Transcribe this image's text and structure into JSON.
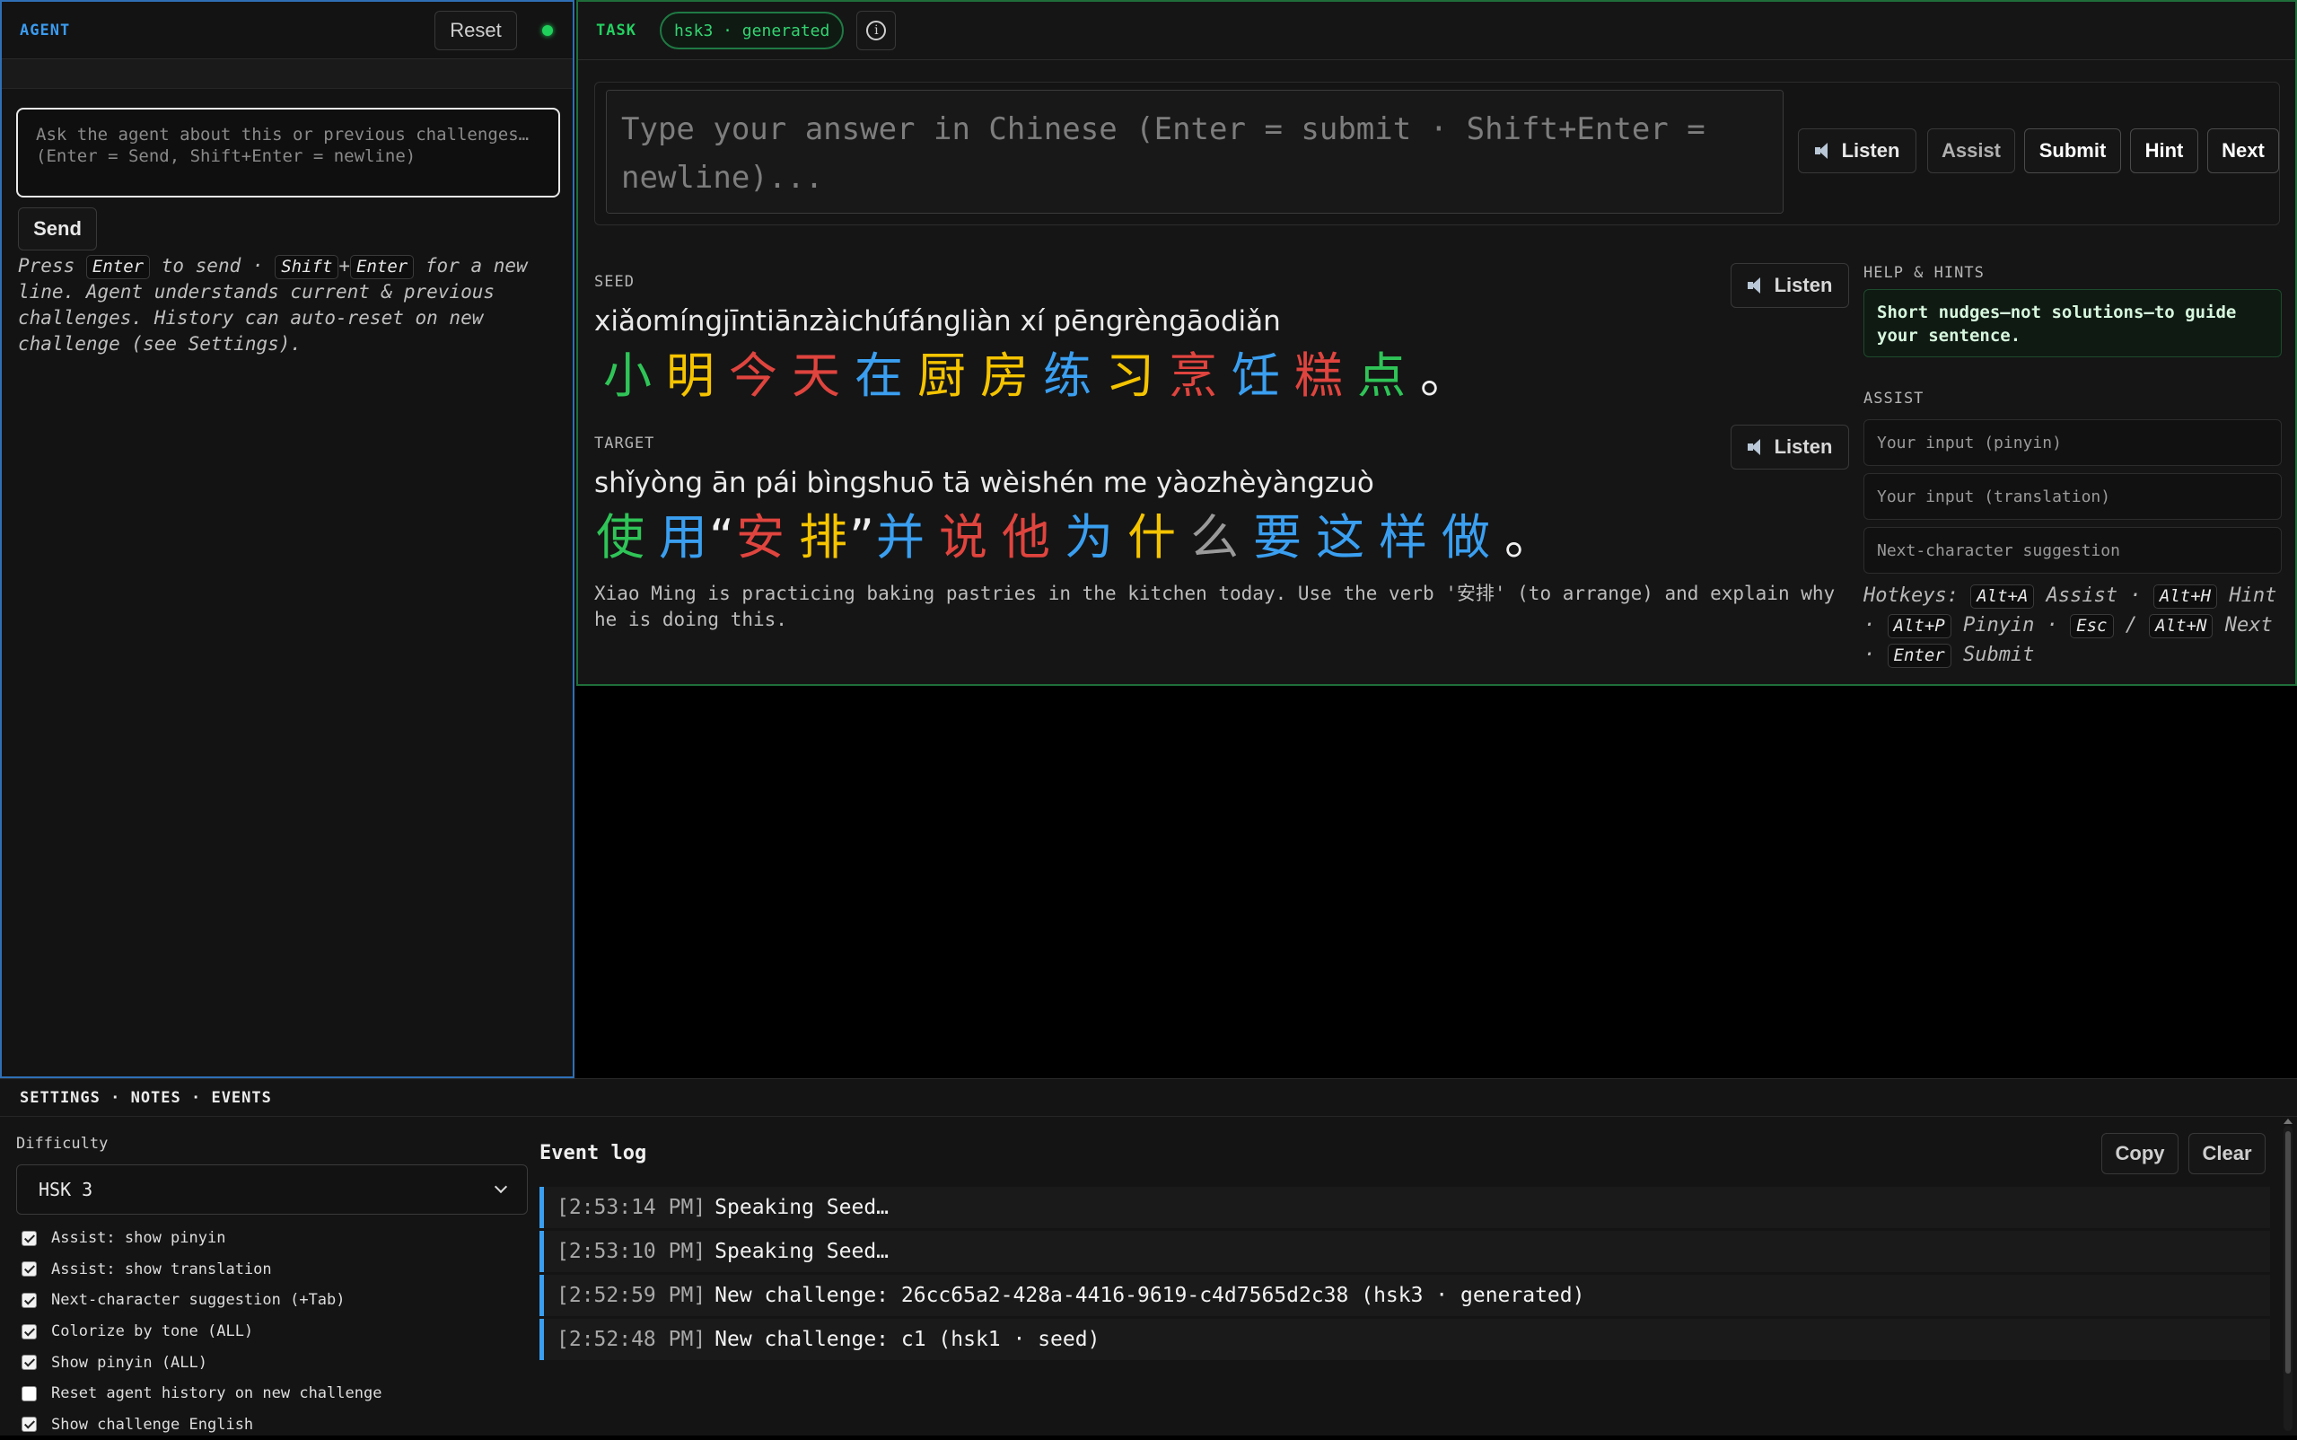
{
  "agent": {
    "title": "AGENT",
    "reset_label": "Reset",
    "input_placeholder": "Ask the agent about this or previous challenges…\n(Enter = Send, Shift+Enter = newline)",
    "send_label": "Send",
    "help_press": "Press",
    "help_enter": "Enter",
    "help_to_send": "to send ·",
    "help_shift": "Shift",
    "help_plus": "+",
    "help_enter2": "Enter",
    "help_rest": "for a new line. Agent understands current & previous challenges. History can auto-reset on new challenge (see Settings)."
  },
  "task": {
    "title": "TASK",
    "badge": "hsk3 · generated",
    "answer_placeholder": "Type your answer in Chinese (Enter = submit · Shift+Enter = newline)...",
    "buttons": {
      "listen": "Listen",
      "assist": "Assist",
      "submit": "Submit",
      "hint": "Hint",
      "next": "Next"
    },
    "seed": {
      "label": "SEED",
      "listen": "Listen",
      "pinyin": "xiǎomíngjīntiānzàichúfángliàn xí pēngrèngāodiǎn",
      "chars": [
        {
          "c": "小",
          "tone": 3
        },
        {
          "c": "明",
          "tone": 2
        },
        {
          "c": "今",
          "tone": 1
        },
        {
          "c": "天",
          "tone": 1
        },
        {
          "c": "在",
          "tone": 4
        },
        {
          "c": "厨",
          "tone": 2
        },
        {
          "c": "房",
          "tone": 2
        },
        {
          "c": "练",
          "tone": 4
        },
        {
          "c": "习",
          "tone": 2
        },
        {
          "c": "烹",
          "tone": 1
        },
        {
          "c": "饪",
          "tone": 4
        },
        {
          "c": "糕",
          "tone": 1
        },
        {
          "c": "点",
          "tone": 3
        },
        {
          "c": "。",
          "tone": 0
        }
      ]
    },
    "target": {
      "label": "TARGET",
      "listen": "Listen",
      "pinyin": "shǐyòng  ān pái  bìngshuō tā  wèishén me  yàozhèyàngzuò",
      "chars": [
        {
          "c": "使",
          "tone": 3
        },
        {
          "c": "用",
          "tone": 4
        },
        {
          "c": "“",
          "tone": 0
        },
        {
          "c": "安",
          "tone": 1
        },
        {
          "c": "排",
          "tone": 2
        },
        {
          "c": "”",
          "tone": 0
        },
        {
          "c": "并",
          "tone": 4
        },
        {
          "c": "说",
          "tone": 1
        },
        {
          "c": "他",
          "tone": 1
        },
        {
          "c": "为",
          "tone": 4
        },
        {
          "c": "什",
          "tone": 2
        },
        {
          "c": "么",
          "tone": 5
        },
        {
          "c": "要",
          "tone": 4
        },
        {
          "c": "这",
          "tone": 4
        },
        {
          "c": "样",
          "tone": 4
        },
        {
          "c": "做",
          "tone": 4
        },
        {
          "c": "。",
          "tone": 0
        }
      ]
    },
    "english": "Xiao Ming is practicing baking pastries in the kitchen today. Use the verb '安排' (to arrange) and explain why he is doing this.",
    "help_label": "HELP & HINTS",
    "nudge": "Short nudges—not solutions—to guide your sentence.",
    "assist_label": "ASSIST",
    "assist_pinyin": "Your input (pinyin)",
    "assist_translation": "Your input (translation)",
    "assist_next": "Next-character suggestion",
    "hotkeys": {
      "label": "Hotkeys:",
      "k1": "Alt+A",
      "d1": "Assist ·",
      "k2": "Alt+H",
      "d2": "Hint ·",
      "k3": "Alt+P",
      "d3": "Pinyin ·",
      "k4": "Esc",
      "sep": "/",
      "k5": "Alt+N",
      "d5": "Next ·",
      "k6": "Enter",
      "d6": "Submit"
    }
  },
  "bottom": {
    "title": "SETTINGS · NOTES · EVENTS",
    "difficulty_label": "Difficulty",
    "difficulty_value": "HSK 3",
    "checkboxes": [
      {
        "label": "Assist: show pinyin",
        "checked": true
      },
      {
        "label": "Assist: show translation",
        "checked": true
      },
      {
        "label": "Next-character suggestion (+Tab)",
        "checked": true
      },
      {
        "label": "Colorize by tone (ALL)",
        "checked": true
      },
      {
        "label": "Show pinyin (ALL)",
        "checked": true
      },
      {
        "label": "Reset agent history on new challenge",
        "checked": false
      },
      {
        "label": "Show challenge English",
        "checked": true
      }
    ],
    "event_title": "Event log",
    "copy_label": "Copy",
    "clear_label": "Clear",
    "events": [
      {
        "ts": "[2:53:14 PM]",
        "msg": "Speaking Seed…"
      },
      {
        "ts": "[2:53:10 PM]",
        "msg": "Speaking Seed…"
      },
      {
        "ts": "[2:52:59 PM]",
        "msg": "New challenge: 26cc65a2-428a-4416-9619-c4d7565d2c38 (hsk3 · generated)"
      },
      {
        "ts": "[2:52:48 PM]",
        "msg": "New challenge: c1 (hsk1 · seed)"
      }
    ]
  },
  "colors": {
    "tone1": "#e0443e",
    "tone2": "#f5c400",
    "tone3": "#2fc457",
    "tone4": "#3a9ff0",
    "neutral": "#9a9a9a",
    "agent_border": "#2f6fb6",
    "task_border": "#1f6e3a"
  }
}
